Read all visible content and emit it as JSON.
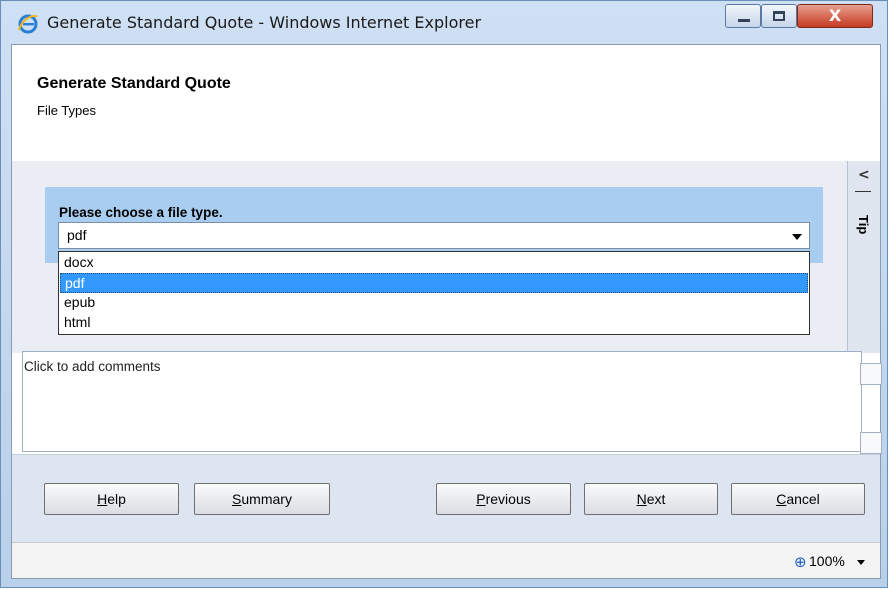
{
  "window": {
    "title": "Generate Standard Quote - Windows Internet Explorer",
    "controls": {
      "minimize_icon": "minimize-icon",
      "maximize_icon": "maximize-icon",
      "close_label": "X"
    }
  },
  "header": {
    "title": "Generate Standard Quote",
    "subtitle": "File Types"
  },
  "form": {
    "prompt": "Please choose a file type.",
    "selected_value": "pdf",
    "options": [
      "docx",
      "pdf",
      "epub",
      "html"
    ],
    "highlighted_option": "pdf"
  },
  "tip_panel": {
    "collapse_glyph": "<",
    "label": "Tip"
  },
  "comments": {
    "placeholder": "Click to add comments"
  },
  "buttons": {
    "help": {
      "mnemonic": "H",
      "rest": "elp"
    },
    "summary": {
      "mnemonic": "S",
      "rest": "ummary"
    },
    "previous": {
      "mnemonic": "P",
      "rest": "revious"
    },
    "next": {
      "mnemonic": "N",
      "rest": "ext"
    },
    "cancel": {
      "mnemonic": "C",
      "rest": "ancel"
    }
  },
  "statusbar": {
    "zoom": "100%"
  },
  "colors": {
    "selection_blue": "#3399ff",
    "band_blue": "#a9cdf0",
    "close_red": "#c63a22"
  }
}
